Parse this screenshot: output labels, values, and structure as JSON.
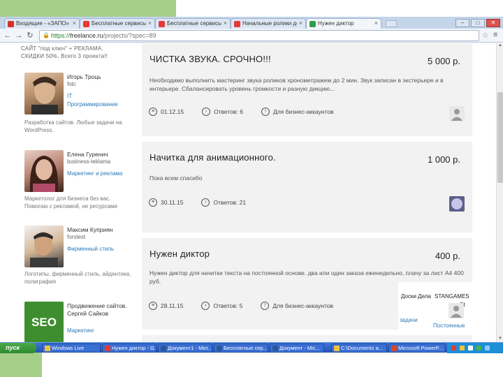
{
  "browser": {
    "tabs": [
      {
        "label": "Входящие - «ЗАПО» (@gm",
        "favicon_color": "#d93025"
      },
      {
        "label": "Бесплатные сервисы",
        "favicon_color": "#e53935"
      },
      {
        "label": "Бесплатные сервисы",
        "favicon_color": "#e53935"
      },
      {
        "label": "Начальные ролики дом",
        "favicon_color": "#e53935"
      },
      {
        "label": "Нужен диктор",
        "favicon_color": "#2e9e44",
        "active": true
      }
    ],
    "url_scheme": "https://",
    "url_host": "freelance.ru",
    "url_path": "/projects/?spec=89",
    "window_buttons": [
      "–",
      "□",
      "✕"
    ]
  },
  "sidebar": {
    "ad_text": "САЙТ \"под ключ\" + РЕКЛАМА. СКИДКИ 50%. Всего 3 проекта!!",
    "freelancers": [
      {
        "name": "Игорь Троць",
        "username": "fotc",
        "skills": [
          "IT",
          "Программирование"
        ],
        "description": "Разработка сайтов. Любые задачи на WordPress.",
        "avatar_colors": [
          "#c9a688",
          "#6d4f3a"
        ]
      },
      {
        "name": "Елена Гуренич",
        "username": "business-teklama",
        "skills": [
          "Маркетинг и реклама"
        ],
        "description": "Маркетолог для бизнеса без вас. Помогаю с рекламой, не ресурсами",
        "avatar_colors": [
          "#c98f7e",
          "#3b2118"
        ]
      },
      {
        "name": "Максим Куприян",
        "username": "forstest",
        "skills": [
          "Фирменный стиль"
        ],
        "description": "Логотипы, фирменный стиль, айдентика, полиграфия",
        "avatar_colors": [
          "#d6b89a",
          "#3b3b3b"
        ]
      },
      {
        "name": "Продвижение сайтов. Сергей Сайков",
        "username": "",
        "skills": [
          "Маркетинг"
        ],
        "description": "",
        "avatar_text": "SEO",
        "avatar_colors": [
          "#3e8e2f",
          "#ffffff"
        ]
      }
    ]
  },
  "projects": [
    {
      "title": "ЧИСТКА ЗВУКА. СРОЧНО!!!",
      "price": "5 000 р.",
      "description": "Необходимо выполнить мастеринг звука роликов хронометражем до 2 мин. Звук записан в экстерьере и в интерьере. Сбалансировать уровень громкости и разную дикцию...",
      "date": "01.12.15",
      "responses": "Ответов: 6",
      "audience": "Для бизнес-аккаунтов"
    },
    {
      "title": "Начитка для анимационного.",
      "price": "1 000 р.",
      "description": "Пока всем спасибо",
      "date": "30.11.15",
      "responses": "Ответов: 21",
      "audience": ""
    },
    {
      "title": "Нужен диктор",
      "price": "400 р.",
      "description": "Нужен диктор для начитки текста на постоянной основе. два или один заказа еженедельно, плачу за лист А4 400 руб.",
      "date": "28.11.15",
      "responses": "Ответов: 5",
      "audience": "Для бизнес-аккаунтов"
    }
  ],
  "overlay": {
    "line1": "Доски Дела",
    "line2": "STANGAMES",
    "line3": "St",
    "line4": "задачи",
    "line5": "Постоянные"
  },
  "taskbar": {
    "start_label": "пуск",
    "items": [
      {
        "label": "Windows Live",
        "icon_color": "#f0c040"
      },
      {
        "label": "Нужен диктор - G...",
        "icon_color": "#e53935"
      },
      {
        "label": "Документ1 - Micr...",
        "icon_color": "#2b5797"
      },
      {
        "label": "Бесплатные сер...",
        "icon_color": "#2b5797"
      },
      {
        "label": "Документ - Mic...",
        "icon_color": "#2b5797"
      },
      {
        "label": "С:\\Documents a...",
        "icon_color": "#f0c040"
      },
      {
        "label": "Microsoft PowerP...",
        "icon_color": "#d24726"
      }
    ]
  }
}
